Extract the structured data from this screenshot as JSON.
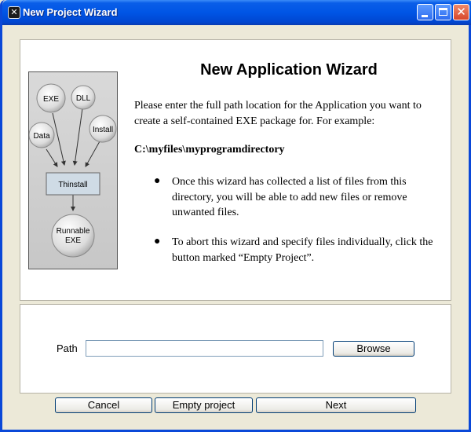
{
  "window": {
    "title": "New Project Wizard",
    "app_icon_glyph": "✕"
  },
  "illustration": {
    "nodes": {
      "exe": "EXE",
      "dll": "DLL",
      "data": "Data",
      "install": "Install",
      "thinstall": "Thinstall",
      "runnable_line1": "Runnable",
      "runnable_line2": "EXE"
    }
  },
  "content": {
    "heading": "New Application Wizard",
    "intro": "Please enter the full path location for the Application you want to create a self-contained EXE package for.  For example:",
    "example_path": "C:\\myfiles\\myprogramdirectory",
    "bullets": [
      "Once this wizard has collected a list of files from this directory, you will be able to add new files or remove unwanted files.",
      "To abort this wizard and specify files individually, click the button marked “Empty Project”."
    ],
    "bullet_glyph": "●"
  },
  "path": {
    "label": "Path",
    "value": "",
    "browse_label": "Browse"
  },
  "buttons": {
    "cancel": "Cancel",
    "empty_project": "Empty project",
    "next": "Next"
  }
}
